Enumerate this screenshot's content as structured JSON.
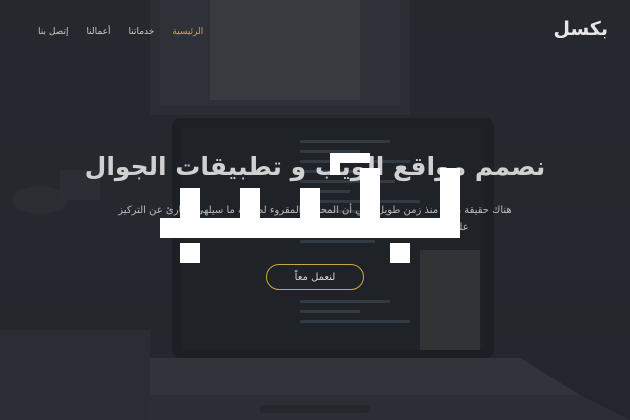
{
  "navbar": {
    "brand": "بكسل",
    "links": [
      "الرئيسية",
      "خدماتنا",
      "أعمالنا",
      "إتصل بنا"
    ],
    "active_index": 0
  },
  "hero": {
    "headline": "نصمم مواقع الويب و تطبيقات الجوال",
    "paragraph": "هناك حقيقة مثبتة منذ زمن طويل وهي أن المحتوى المقروء لصفحة ما سيلهي القارئ عن التركيز على الشكل الخارجي للنص أو شكل توضع الفقرات في الصفحة التي يقرأها",
    "cta_label": "لنعمل معاً"
  },
  "watermark": {
    "text": "بكسل"
  },
  "colors": {
    "accent": "#c9a743",
    "text": "#d0d0d0",
    "overlay": "#1e2026"
  }
}
